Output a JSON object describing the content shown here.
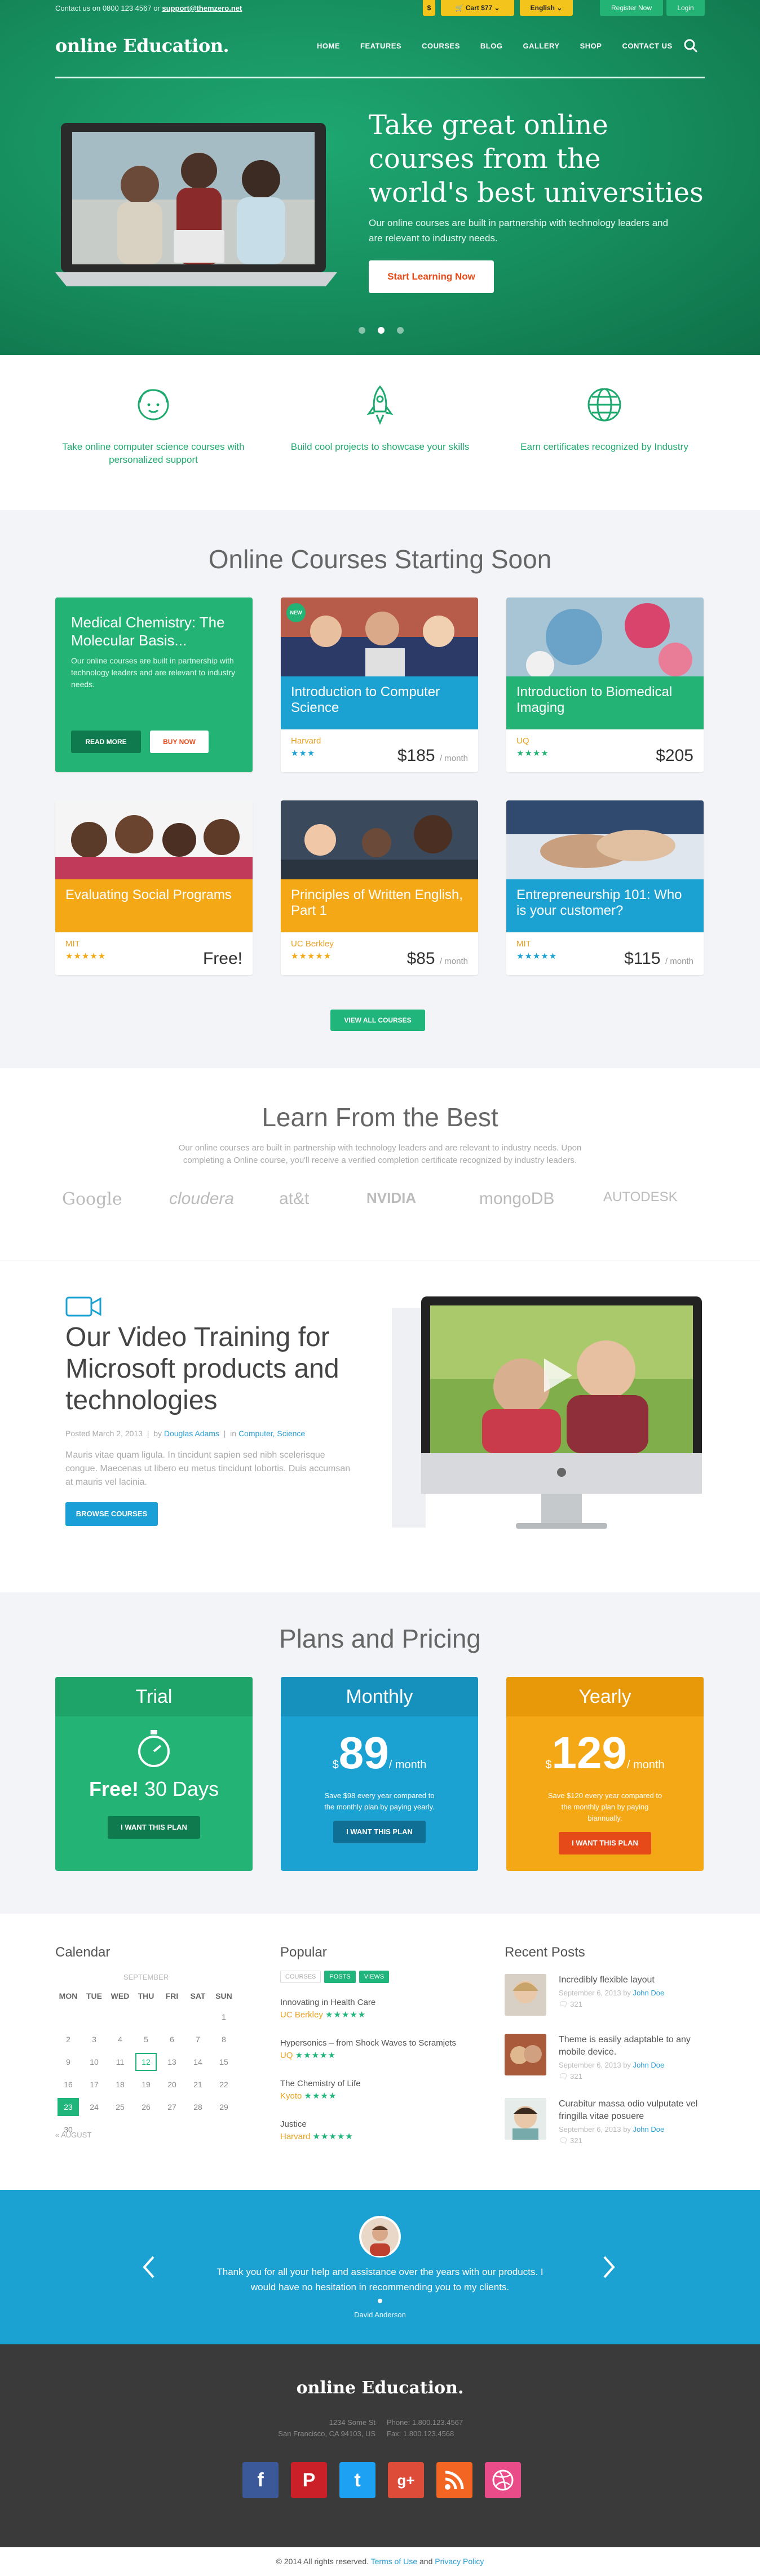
{
  "topbar": {
    "contact_prefix": "Contact us on 0800 123 4567 or",
    "contact_email": "support@themzero.net",
    "dollar": "$",
    "cart": "Cart",
    "cart_amount": "$77",
    "language": "English",
    "register": "Register Now",
    "login": "Login"
  },
  "header": {
    "logo": "online Education.",
    "nav": [
      "HOME",
      "FEATURES",
      "COURSES",
      "BLOG",
      "GALLERY",
      "SHOP",
      "CONTACT US"
    ]
  },
  "hero": {
    "title": "Take great online courses from the world's best universities",
    "subtitle": "Our online courses are built in partnership with technology leaders and are relevant to industry needs.",
    "cta": "Start Learning Now",
    "slides": 3,
    "active_slide": 1
  },
  "features": [
    {
      "icon": "face-icon",
      "text": "Take online computer science courses with personalized support"
    },
    {
      "icon": "rocket-icon",
      "text": "Build cool projects to showcase your skills"
    },
    {
      "icon": "globe-icon",
      "text": "Earn certificates recognized by Industry"
    }
  ],
  "courses": {
    "title": "Online Courses Starting Soon",
    "featured": {
      "title": "Medical Chemistry: The Molecular Basis...",
      "desc": "Our online courses are built in partnership with technology leaders and are relevant to industry needs.",
      "read_more": "READ MORE",
      "buy_now": "BUY NOW"
    },
    "items": [
      {
        "title": "Introduction to Computer Science",
        "source": "Harvard",
        "rating": 3,
        "price": "$185",
        "period": "/ month",
        "color": "#1ba2d2",
        "badge": "NEW"
      },
      {
        "title": "Introduction to Biomedical Imaging",
        "source": "UQ",
        "rating": 4,
        "price": "$205",
        "period": "",
        "color": "#23b374",
        "badge": ""
      },
      {
        "title": "Evaluating Social Programs",
        "source": "MIT",
        "rating": 5,
        "price": "Free!",
        "period": "",
        "color": "#f5a815",
        "badge": ""
      },
      {
        "title": "Principles of Written English, Part 1",
        "source": "UC Berkley",
        "rating": 5,
        "price": "$85",
        "period": "/ month",
        "color": "#f5a815",
        "badge": ""
      },
      {
        "title": "Entrepreneurship 101: Who is your customer?",
        "source": "MIT",
        "rating": 5,
        "price": "$115",
        "period": "/ month",
        "color": "#1ba2d2",
        "badge": ""
      }
    ],
    "view_all": "VIEW ALL COURSES"
  },
  "partners": {
    "title": "Learn From the Best",
    "subtitle": "Our online courses are built in partnership with technology leaders and are relevant to industry needs. Upon completing a Online course, you'll receive a verified completion certificate recognized by industry leaders.",
    "logos": [
      "Google",
      "cloudera",
      "at&t",
      "NVIDIA",
      "mongoDB",
      "AUTODESK"
    ]
  },
  "video": {
    "title": "Our Video Training for Microsoft products and technologies",
    "posted": "Posted March 2, 2013",
    "by": "by",
    "author": "Douglas Adams",
    "in": "in",
    "categories": "Computer, Science",
    "desc": "Mauris vitae quam ligula. In tincidunt sapien sed nibh scelerisque congue. Maecenas ut libero eu metus tincidunt lobortis. Duis accumsan at mauris vel lacinia.",
    "button": "BROWSE COURSES"
  },
  "pricing": {
    "title": "Plans and Pricing",
    "plans": [
      {
        "name": "Trial",
        "amount": "Free!",
        "period": "30 Days",
        "note": "",
        "button": "I WANT THIS PLAN",
        "color": "#23b374",
        "header": "#1ea469"
      },
      {
        "name": "Monthly",
        "amount": "89",
        "period": "/ month",
        "note": "Save $98 every year compared to the monthly plan by paying yearly.",
        "button": "I WANT THIS PLAN",
        "color": "#1ba2d2",
        "header": "#1691be"
      },
      {
        "name": "Yearly",
        "amount": "129",
        "period": "/ month",
        "note": "Save $120 every year compared to the monthly plan by paying biannually.",
        "button": "I WANT THIS PLAN",
        "color": "#f5a815",
        "header": "#e8990a"
      }
    ]
  },
  "calendar": {
    "title": "Calendar",
    "month": "SEPTEMBER",
    "days": [
      "MON",
      "TUE",
      "WED",
      "THU",
      "FRI",
      "SAT",
      "SUN"
    ],
    "weeks": [
      [
        "",
        "",
        "",
        "",
        "",
        "",
        "1"
      ],
      [
        "2",
        "3",
        "4",
        "5",
        "6",
        "7",
        "8"
      ],
      [
        "9",
        "10",
        "11",
        "12",
        "13",
        "14",
        "15"
      ],
      [
        "16",
        "17",
        "18",
        "19",
        "20",
        "21",
        "22"
      ],
      [
        "23",
        "24",
        "25",
        "26",
        "27",
        "28",
        "29"
      ],
      [
        "30",
        "",
        "",
        "",
        "",
        "",
        ""
      ]
    ],
    "prev": "« AUGUST"
  },
  "popular": {
    "title": "Popular",
    "tabs": [
      "COURSES",
      "POSTS",
      "VIEWS"
    ],
    "items": [
      {
        "title": "Innovating in Health Care",
        "source": "UC Berkley",
        "rating": "★★★★★"
      },
      {
        "title": "Hypersonics – from Shock Waves to Scramjets",
        "source": "UQ",
        "rating": "★★★★★"
      },
      {
        "title": "The Chemistry of Life",
        "source": "Kyoto",
        "rating": "★★★★"
      },
      {
        "title": "Justice",
        "source": "Harvard",
        "rating": "★★★★★"
      }
    ]
  },
  "recent": {
    "title": "Recent Posts",
    "items": [
      {
        "title": "Incredibly flexible layout",
        "date": "September 6, 2013",
        "by": "by",
        "author": "John Doe",
        "comments": "321"
      },
      {
        "title": "Theme is easily adaptable to any mobile device.",
        "date": "September 6, 2013",
        "by": "by",
        "author": "John Doe",
        "comments": "321"
      },
      {
        "title": "Curabitur massa odio vulputate vel fringilla vitae posuere",
        "date": "September 6, 2013",
        "by": "by",
        "author": "John Doe",
        "comments": "321"
      }
    ]
  },
  "testimonial": {
    "text": "Thank you for all your help and assistance over the years with our products. I would have no hesitation in recommending you to my clients.",
    "name": "David Anderson"
  },
  "footer": {
    "logo": "online Education.",
    "address1": "1234 Some St",
    "address2": "San Francisco, CA 94103, US",
    "phone": "Phone: 1.800.123.4567",
    "fax": "Fax: 1.800.123.4568",
    "social": [
      "facebook-icon",
      "pinterest-icon",
      "twitter-icon",
      "googleplus-icon",
      "rss-icon",
      "dribbble-icon"
    ],
    "copyright": "© 2014 All rights reserved.",
    "terms": "Terms of Use",
    "and": "and",
    "privacy": "Privacy Policy"
  }
}
